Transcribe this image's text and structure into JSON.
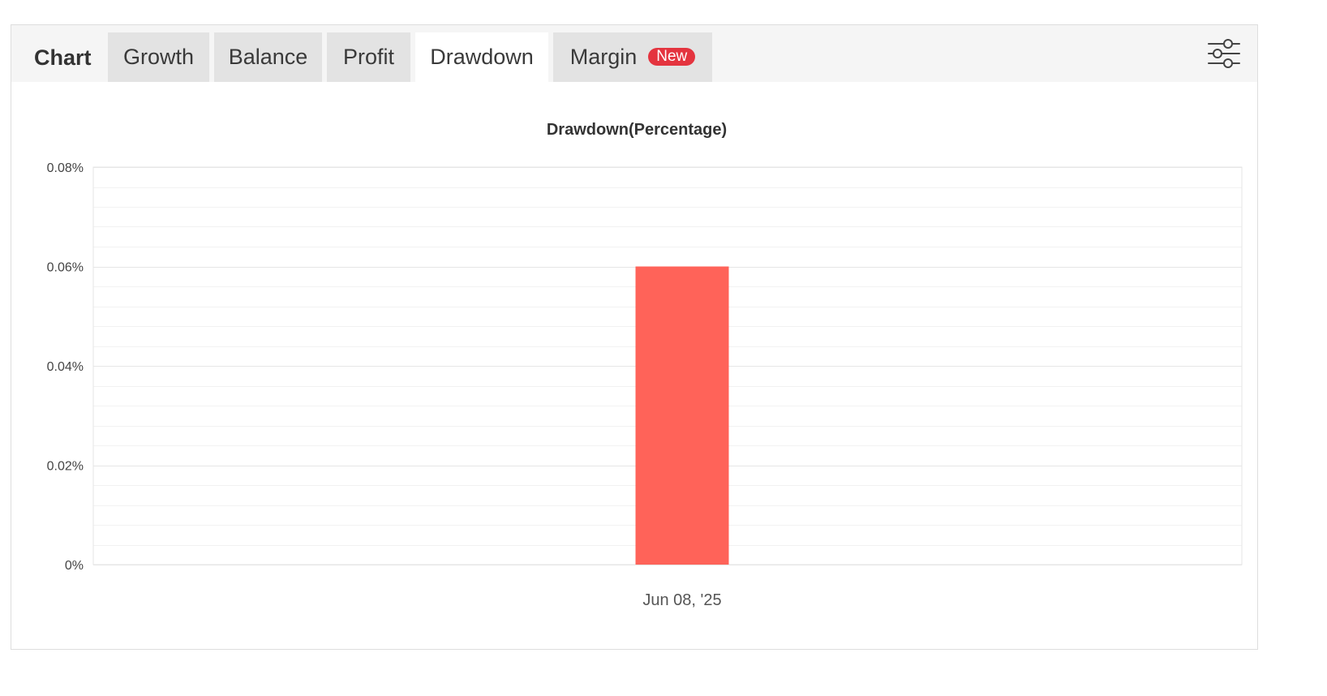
{
  "tabs": {
    "heading": "Chart",
    "items": [
      {
        "label": "Growth"
      },
      {
        "label": "Balance"
      },
      {
        "label": "Profit"
      },
      {
        "label": "Drawdown"
      },
      {
        "label": "Margin",
        "badge": "New"
      }
    ],
    "active": "Drawdown"
  },
  "icons": {
    "settings": "sliders-icon"
  },
  "colors": {
    "bar": "#ff6359",
    "badge": "#e4343f"
  },
  "chart_data": {
    "type": "bar",
    "title": "Drawdown(Percentage)",
    "categories": [
      "Jun 08, '25"
    ],
    "values": [
      0.06
    ],
    "ylim": [
      0,
      0.08
    ],
    "yticks": [
      0,
      0.02,
      0.04,
      0.06,
      0.08
    ],
    "ytick_labels": [
      "0%",
      "0.02%",
      "0.04%",
      "0.06%",
      "0.08%"
    ],
    "xlabel": "",
    "ylabel": "",
    "grid": true,
    "legend": false
  }
}
